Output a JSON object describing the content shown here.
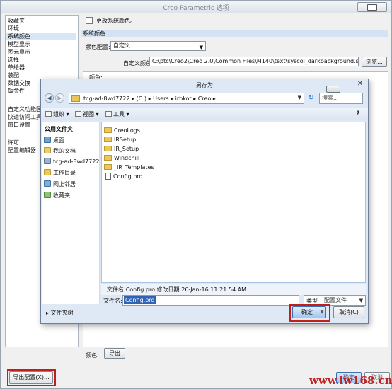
{
  "main_window": {
    "title": "Creo Parametric 选项"
  },
  "nav": {
    "items": [
      "收藏夹",
      "环境",
      "系统颜色",
      "模型显示",
      "图元显示",
      "选择",
      "草绘器",
      "装配",
      "数据交换",
      "钣金件",
      "自定义功能区",
      "快速访问工具栏",
      "窗口设置",
      "许可",
      "配置编辑器"
    ],
    "selected_index": 2
  },
  "content": {
    "change_color_label": "更改系统颜色。",
    "section_header": "系统颜色",
    "color_config_label": "颜色配置:",
    "color_config_value": "自定义",
    "custom_color_file_label": "自定义颜色文件:",
    "custom_color_file_path": "C:\\ptc\\Creo2\\Creo 2.0\\Common Files\\M140\\text\\syscol_darkbackground.scl",
    "browse_label": "浏览...",
    "colors_label": "颜色:",
    "colors_bottom_label": "颜色:",
    "export_colors_label": "导出"
  },
  "footer": {
    "export_config_label": "导出配置(X)...",
    "ok_label": "确定",
    "cancel_label": "取消"
  },
  "watermark": "www.iw168.cn",
  "dialog": {
    "title": "另存为",
    "address": "tcg-ad-8wd7722 ▸ (C:) ▸ Users ▸ irbkot ▸ Creo ▸",
    "search_placeholder": "搜索...",
    "toolbar": {
      "organize": "组织",
      "views": "视图",
      "tools": "工具"
    },
    "tree": {
      "header": "公用文件夹",
      "items": [
        "桌面",
        "我的文档",
        "tcg-ad-8wd7722",
        "工作目录",
        "网上邻居",
        "收藏夹"
      ]
    },
    "files": [
      {
        "name": "CreoLogs",
        "kind": "folder"
      },
      {
        "name": "IRSetup",
        "kind": "folder"
      },
      {
        "name": "IR_Setup",
        "kind": "folder"
      },
      {
        "name": "Windchill",
        "kind": "folder"
      },
      {
        "name": "_IR_Templates",
        "kind": "folder"
      },
      {
        "name": "Config.pro",
        "kind": "file"
      }
    ],
    "detail": "文件名:Config.pro  修改日期:26-Jan-16 11:21:54 AM",
    "filename_label": "文件名:",
    "filename_value": "Config.pro",
    "type_label": "类型",
    "type_value": "配置文件",
    "folders_toggle": "▸ 文件夹树",
    "ok_label": "确定",
    "cancel_label": "取消(C)"
  },
  "colors": {
    "selection": "#d7e7f7",
    "section_header": "#d3e3f4",
    "highlight_box": "#c0201c",
    "filename_selected": "#3163b5"
  }
}
